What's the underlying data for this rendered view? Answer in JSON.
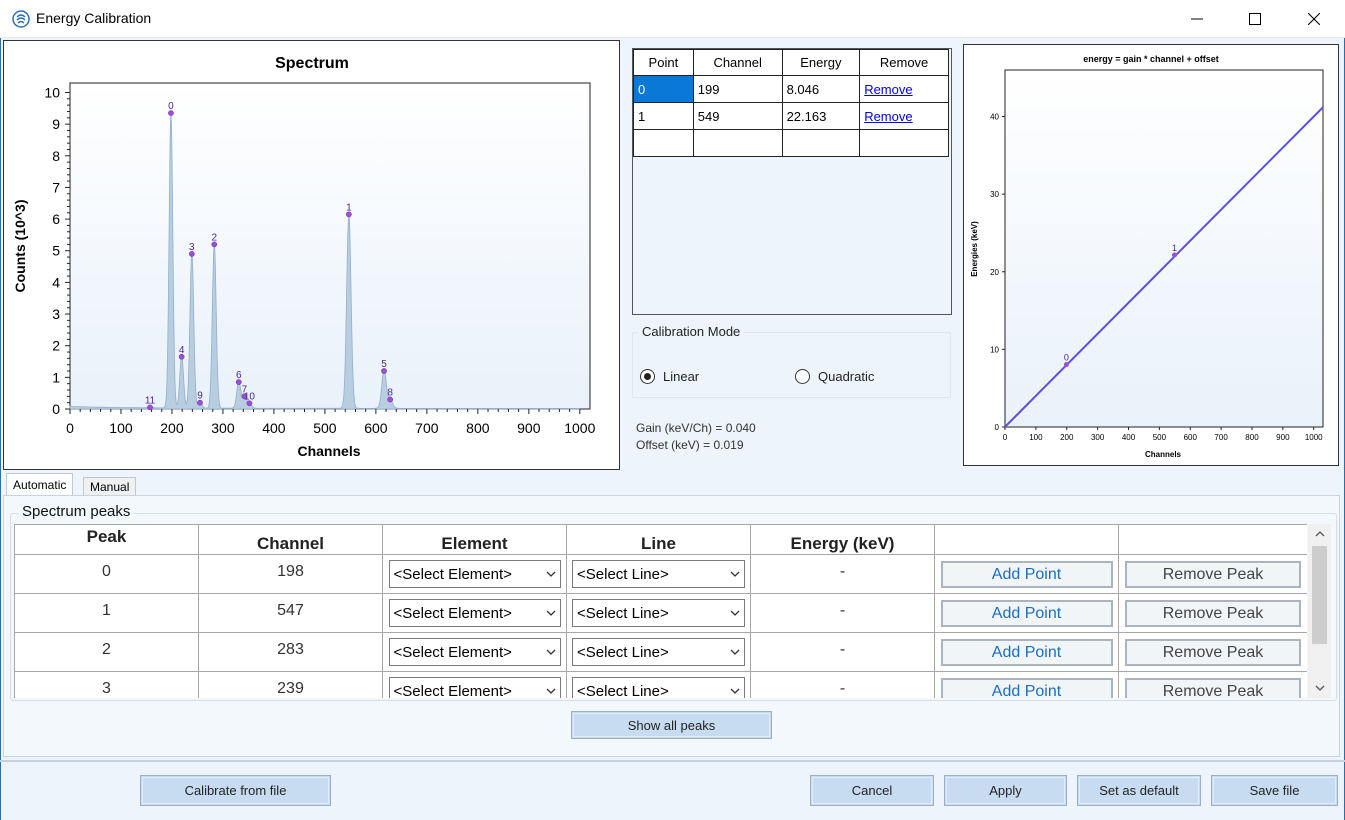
{
  "window": {
    "title": "Energy Calibration",
    "icon": "app-logo-icon",
    "controls": [
      "minimize-icon",
      "maximize-icon",
      "close-icon"
    ]
  },
  "spectrum_chart": {
    "title": "Spectrum",
    "xlabel": "Channels",
    "ylabel": "Counts (10^3)",
    "x_ticks": [
      "0",
      "100",
      "200",
      "300",
      "400",
      "500",
      "600",
      "700",
      "800",
      "900",
      "1000"
    ],
    "y_ticks": [
      "0",
      "1",
      "2",
      "3",
      "4",
      "5",
      "6",
      "7",
      "8",
      "9",
      "10"
    ]
  },
  "calibration_chart": {
    "title": "energy = gain * channel + offset",
    "xlabel": "Channels",
    "ylabel": "Energies (keV)",
    "x_ticks": [
      "0",
      "100",
      "200",
      "300",
      "400",
      "500",
      "600",
      "700",
      "800",
      "900",
      "1000"
    ],
    "y_ticks": [
      "0",
      "10",
      "20",
      "30",
      "40"
    ]
  },
  "chart_data": [
    {
      "type": "area",
      "title": "Spectrum",
      "xlabel": "Channels",
      "ylabel": "Counts (10^3)",
      "xlim": [
        0,
        1020
      ],
      "ylim": [
        0,
        10.3
      ],
      "peaks": [
        {
          "label": "0",
          "channel": 198,
          "counts": 9.35
        },
        {
          "label": "1",
          "channel": 547,
          "counts": 6.15
        },
        {
          "label": "2",
          "channel": 283,
          "counts": 5.2
        },
        {
          "label": "3",
          "channel": 239,
          "counts": 4.9
        },
        {
          "label": "4",
          "channel": 219,
          "counts": 1.65
        },
        {
          "label": "5",
          "channel": 616,
          "counts": 1.2
        },
        {
          "label": "6",
          "channel": 331,
          "counts": 0.85
        },
        {
          "label": "7",
          "channel": 342,
          "counts": 0.4
        },
        {
          "label": "8",
          "channel": 628,
          "counts": 0.3
        },
        {
          "label": "9",
          "channel": 255,
          "counts": 0.2
        },
        {
          "label": "10",
          "channel": 352,
          "counts": 0.18
        },
        {
          "label": "11",
          "channel": 157,
          "counts": 0.05
        }
      ]
    },
    {
      "type": "line",
      "title": "energy = gain * channel + offset",
      "xlabel": "Channels",
      "ylabel": "Energies (keV)",
      "xlim": [
        0,
        1030
      ],
      "ylim": [
        0,
        46
      ],
      "line": {
        "x": [
          0,
          1030
        ],
        "y": [
          0.019,
          41.2
        ]
      },
      "points": [
        {
          "label": "0",
          "x": 199,
          "y": 8.046
        },
        {
          "label": "1",
          "x": 549,
          "y": 22.163
        }
      ]
    }
  ],
  "points_table": {
    "headers": [
      "Point",
      "Channel",
      "Energy",
      "Remove"
    ],
    "rows": [
      {
        "point": "0",
        "channel": "199",
        "energy": "8.046",
        "remove": "Remove"
      },
      {
        "point": "1",
        "channel": "549",
        "energy": "22.163",
        "remove": "Remove"
      }
    ]
  },
  "calibration_mode": {
    "title": "Calibration Mode",
    "linear": "Linear",
    "quadratic": "Quadratic",
    "selected": "Linear"
  },
  "results": {
    "gain": "Gain (keV/Ch) = 0.040",
    "offset": "Offset (keV) = 0.019"
  },
  "tabs": [
    "Automatic",
    "Manual"
  ],
  "peaks_group": {
    "title": "Spectrum peaks",
    "headers": [
      "Peak",
      "Channel",
      "Element",
      "Line",
      "Energy (keV)",
      "",
      ""
    ],
    "rows": [
      {
        "peak": "0",
        "channel": "198",
        "element": "<Select Element>",
        "line": "<Select Line>",
        "energy": "-",
        "add": "Add Point",
        "remove": "Remove Peak"
      },
      {
        "peak": "1",
        "channel": "547",
        "element": "<Select Element>",
        "line": "<Select Line>",
        "energy": "-",
        "add": "Add Point",
        "remove": "Remove Peak"
      },
      {
        "peak": "2",
        "channel": "283",
        "element": "<Select Element>",
        "line": "<Select Line>",
        "energy": "-",
        "add": "Add Point",
        "remove": "Remove Peak"
      },
      {
        "peak": "3",
        "channel": "239",
        "element": "<Select Element>",
        "line": "<Select Line>",
        "energy": "-",
        "add": "Add Point",
        "remove": "Remove Peak"
      }
    ],
    "show_all": "Show all peaks"
  },
  "footer": {
    "calibrate_from_file": "Calibrate from file",
    "cancel": "Cancel",
    "apply": "Apply",
    "set_default": "Set as default",
    "save_file": "Save file"
  },
  "colors": {
    "spectrum_fill": "#b9cde0",
    "spectrum_stroke": "#8fb0cf",
    "peak_marker": "#9b4fd6",
    "calibration_line": "#5a4fe0",
    "selection": "#0a78d7",
    "button": "#c7dcf0"
  }
}
